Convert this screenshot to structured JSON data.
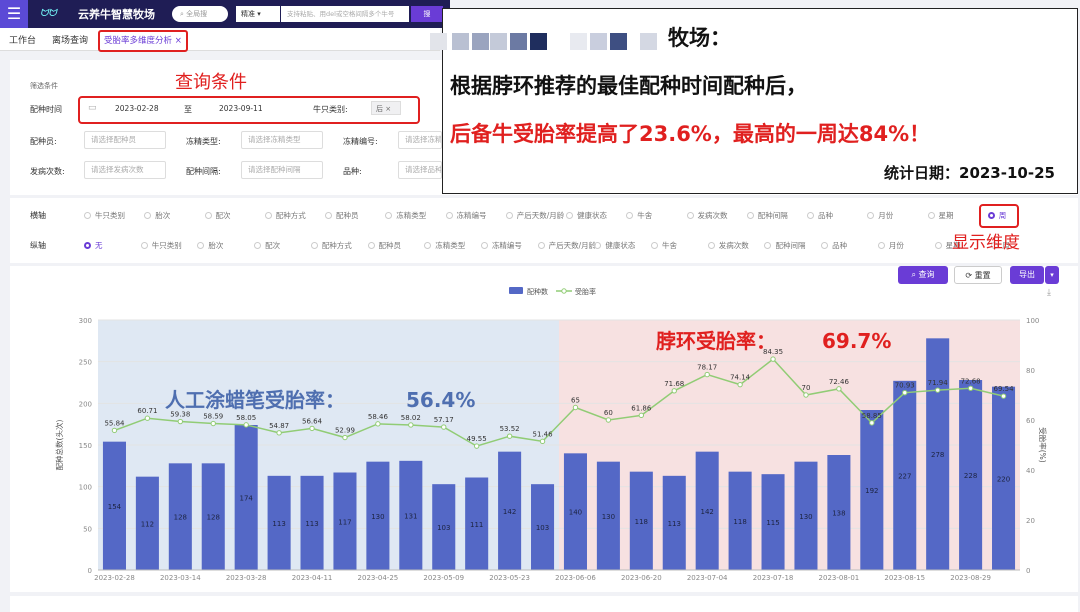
{
  "header": {
    "app_title": "云养牛智慧牧场",
    "search_placeholder": "全局搜",
    "precise_label": "精准",
    "multi_search_placeholder": "支持粘贴、用del或空格间隔多个牛号",
    "search_button": "搜"
  },
  "tabs": [
    {
      "label": "工作台"
    },
    {
      "label": "离场查询"
    },
    {
      "label": "受胎率多维度分析 ×"
    }
  ],
  "filters": {
    "section_label": "筛选条件",
    "annotation": "查询条件",
    "breed_time_label": "配种时间",
    "date_start": "2023-02-28",
    "date_sep": "至",
    "date_end": "2023-09-11",
    "cattle_type_label": "牛只类别:",
    "cattle_type_value": "后",
    "inseminator_label": "配种员:",
    "inseminator_placeholder": "请选择配种员",
    "semen_type_label": "冻精类型:",
    "semen_type_placeholder": "请选择冻精类型",
    "semen_no_label": "冻精编号:",
    "semen_no_placeholder": "请选择冻精",
    "estrus_label": "发病次数:",
    "estrus_placeholder": "请选择发病次数",
    "interval_label": "配种间隔:",
    "interval_placeholder": "请选择配种间隔",
    "breed_label": "品种:",
    "breed_placeholder": "请选择品种"
  },
  "axes": {
    "x_label": "横轴",
    "x_options": [
      "牛只类别",
      "胎次",
      "配次",
      "配种方式",
      "配种员",
      "冻精类型",
      "冻精编号",
      "产后天数/月龄",
      "健康状态",
      "牛舍",
      "发病次数",
      "配种间隔",
      "品种",
      "月份",
      "星期",
      "周"
    ],
    "x_selected": "周",
    "dimension_annotation": "显示维度",
    "y_label": "纵轴",
    "y_options": [
      "无",
      "牛只类别",
      "胎次",
      "配次",
      "配种方式",
      "配种员",
      "冻精类型",
      "冻精编号",
      "产后天数/月龄",
      "健康状态",
      "牛舍",
      "发病次数",
      "配种间隔",
      "品种",
      "月份",
      "星期",
      "周"
    ],
    "y_selected": "无"
  },
  "buttons": {
    "query": "查询",
    "reset": "重置",
    "export": "导出"
  },
  "overlay": {
    "title": "牧场：",
    "line1": "根据脖环推荐的最佳配种时间配种后，",
    "line2": "后备牛受胎率提高了23.6%，最高的一周达84%！",
    "date": "统计日期：2023-10-25"
  },
  "annotations": {
    "left_label": "人工涂蜡笔受胎率：",
    "left_value": "56.4%",
    "right_label": "脖环受胎率：",
    "right_value": "69.7%"
  },
  "colors": {
    "accent": "#6a3cd6",
    "bar": "#5468c6",
    "line": "#91cc75",
    "annotation_red": "#e0201f",
    "annotation_blue": "#4f6fb0",
    "left_zone": "#dfe8f3",
    "right_zone": "#f7e1e1"
  },
  "chart_data": {
    "type": "bar",
    "legend": [
      "配种数",
      "受胎率"
    ],
    "ylabel": "配种总数(头次)",
    "y2label": "受胎率(%)",
    "ylim": [
      0,
      300
    ],
    "y2lim": [
      0,
      100
    ],
    "categories": [
      "2023-02-28",
      "2023-03-07",
      "2023-03-14",
      "2023-03-21",
      "2023-03-28",
      "2023-04-04",
      "2023-04-11",
      "2023-04-18",
      "2023-04-25",
      "2023-05-02",
      "2023-05-09",
      "2023-05-16",
      "2023-05-23",
      "2023-05-30",
      "2023-06-06",
      "2023-06-13",
      "2023-06-20",
      "2023-06-27",
      "2023-07-04",
      "2023-07-11",
      "2023-07-18",
      "2023-07-25",
      "2023-08-01",
      "2023-08-08",
      "2023-08-15",
      "2023-08-22",
      "2023-08-29",
      "2023-09-05"
    ],
    "x_tick_labels": [
      "2023-02-28",
      "2023-03-14",
      "2023-03-28",
      "2023-04-11",
      "2023-04-25",
      "2023-05-09",
      "2023-05-23",
      "2023-06-06",
      "2023-06-20",
      "2023-07-04",
      "2023-07-18",
      "2023-08-01",
      "2023-08-15",
      "2023-08-29"
    ],
    "series": [
      {
        "name": "配种数",
        "type": "bar",
        "values": [
          154,
          112,
          128,
          128,
          174,
          113,
          113,
          117,
          130,
          131,
          103,
          111,
          142,
          103,
          140,
          130,
          118,
          113,
          142,
          118,
          115,
          130,
          138,
          192,
          227,
          278,
          228,
          220
        ]
      },
      {
        "name": "受胎率",
        "type": "line",
        "values": [
          55.84,
          60.71,
          59.38,
          58.59,
          58.05,
          54.87,
          56.64,
          52.99,
          58.46,
          58.02,
          57.17,
          49.55,
          53.52,
          51.46,
          65,
          60,
          61.86,
          71.68,
          78.17,
          74.14,
          84.35,
          70,
          72.46,
          58.85,
          70.93,
          71.94,
          72.68,
          69.54
        ]
      }
    ]
  }
}
